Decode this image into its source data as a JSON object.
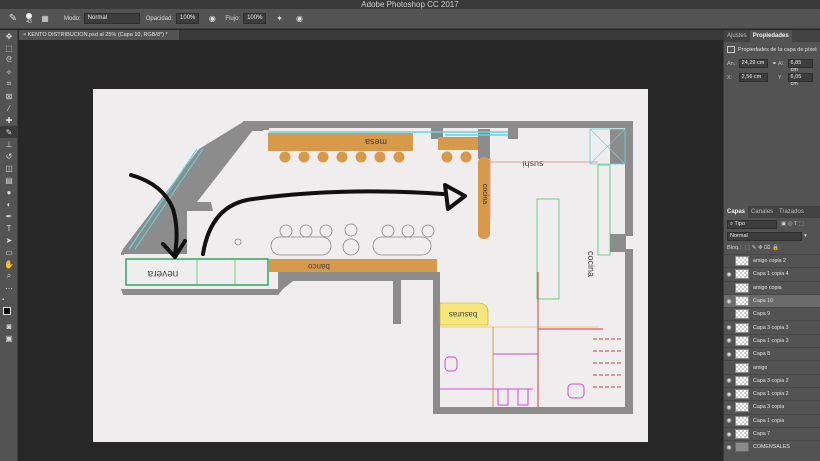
{
  "app": {
    "title": "Adobe Photoshop CC 2017"
  },
  "options_bar": {
    "brush_size": "43",
    "mode_label": "Modo:",
    "mode_value": "Normal",
    "opacity_label": "Opacidad:",
    "opacity_value": "100%",
    "flow_label": "Flujo:",
    "flow_value": "100%"
  },
  "document": {
    "tab_title": "KENTO DISTRIBUCION.psd al 25% (Capa 10, RGB/8*) *"
  },
  "floorplan": {
    "labels": {
      "mesa": "mesa",
      "sushi": "sushi",
      "cocina": "cocina",
      "nevera": "nevera",
      "banco": "banco",
      "basuras": "basuras",
      "vertical_label": "cocina"
    }
  },
  "properties_panel": {
    "tabs": [
      "Ajustes",
      "Propiedades"
    ],
    "active_tab": "Propiedades",
    "header": "Propiedades de la capa de píxeles",
    "w_label": "An.:",
    "w_value": "24,29 cm",
    "h_label": "Al.:",
    "h_value": "6,85 cm",
    "x_label": "X:",
    "x_value": "2,56 cm",
    "y_label": "Y:",
    "y_value": "6,05 cm"
  },
  "layers_panel": {
    "tabs": [
      "Capas",
      "Canales",
      "Trazados"
    ],
    "active_tab": "Capas",
    "filter_value": "Tipo",
    "blend_mode": "Normal",
    "lock_label": "Bloq.:",
    "layers": [
      {
        "name": "amigo copia 2",
        "visible": false,
        "selected": false,
        "folder": false
      },
      {
        "name": "Capa 1 copia 4",
        "visible": true,
        "selected": false,
        "folder": false
      },
      {
        "name": "amigo copia",
        "visible": false,
        "selected": false,
        "folder": false
      },
      {
        "name": "Capa 10",
        "visible": true,
        "selected": true,
        "folder": false
      },
      {
        "name": "Capa 9",
        "visible": false,
        "selected": false,
        "folder": false
      },
      {
        "name": "Capa 3 copia 3",
        "visible": true,
        "selected": false,
        "folder": false
      },
      {
        "name": "Capa 1 copia 3",
        "visible": true,
        "selected": false,
        "folder": false
      },
      {
        "name": "Capa 8",
        "visible": true,
        "selected": false,
        "folder": false
      },
      {
        "name": "amigo",
        "visible": false,
        "selected": false,
        "folder": false
      },
      {
        "name": "Capa 3 copia 2",
        "visible": true,
        "selected": false,
        "folder": false
      },
      {
        "name": "Capa 1 copia 2",
        "visible": true,
        "selected": false,
        "folder": false
      },
      {
        "name": "Capa 3 copia",
        "visible": true,
        "selected": false,
        "folder": false
      },
      {
        "name": "Capa 1 copia",
        "visible": true,
        "selected": false,
        "folder": false
      },
      {
        "name": "Capa 7",
        "visible": true,
        "selected": false,
        "folder": false
      },
      {
        "name": "COMENSALES",
        "visible": true,
        "selected": false,
        "folder": true
      }
    ]
  },
  "colors": {
    "wall": "#8c8c8c",
    "wood": "#d69a4a",
    "yellow": "#f5e77a",
    "cyan": "#5fd8e0",
    "green": "#4fc96a",
    "red": "#d23b3b",
    "magenta": "#d24bd2"
  }
}
